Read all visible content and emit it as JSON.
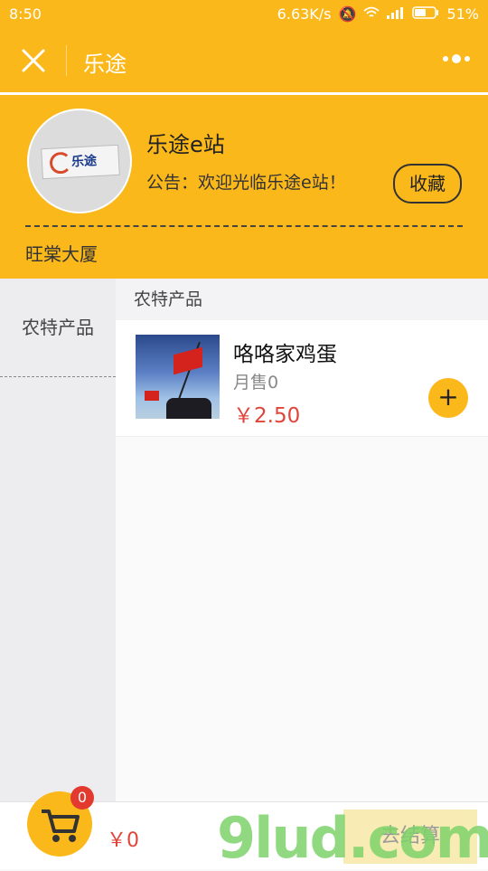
{
  "status_bar": {
    "time": "8:50",
    "network_speed": "6.63K/s",
    "battery": "51%"
  },
  "navbar": {
    "title": "乐途"
  },
  "shop": {
    "logo_text": "乐途",
    "name": "乐途e站",
    "notice": "公告：欢迎光临乐途e站！",
    "favorite_label": "收藏",
    "address": "旺棠大厦"
  },
  "categories": [
    {
      "label": "农特产品"
    }
  ],
  "section_title": "农特产品",
  "products": [
    {
      "name": "咯咯家鸡蛋",
      "sales": "月售0",
      "price": "￥2.50"
    }
  ],
  "cart": {
    "badge_count": "0",
    "total": "￥0",
    "checkout_label": "去结算"
  },
  "watermark": "9lud.com",
  "colors": {
    "brand": "#fbb81b",
    "price": "#e0453a",
    "badge": "#e3392f"
  }
}
